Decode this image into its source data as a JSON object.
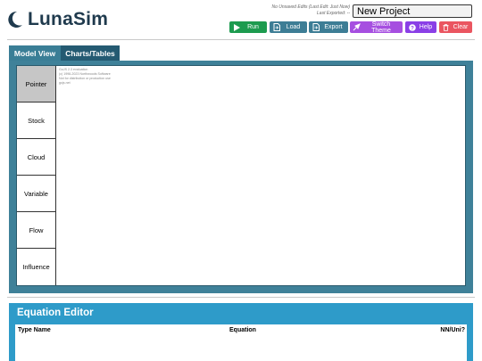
{
  "app": {
    "title": "LunaSim",
    "saved_note_line1": "No Unsaved Edits (Last Edit: Just Now)",
    "saved_note_line2": "Last Exported: --",
    "project_name": "New Project"
  },
  "toolbar": {
    "buttons": [
      {
        "label": "Run",
        "icon": "play-icon",
        "color": "#1d9b4f"
      },
      {
        "label": "Load",
        "icon": "file-load-icon",
        "color": "#3d7d95"
      },
      {
        "label": "Export",
        "icon": "file-export-icon",
        "color": "#3d7d95"
      },
      {
        "label": "Switch Theme",
        "icon": "theme-icon",
        "color": "#a64fe0"
      },
      {
        "label": "Help",
        "icon": "help-icon",
        "color": "#8a3fe6"
      },
      {
        "label": "Clear",
        "icon": "trash-icon",
        "color": "#ea5560"
      }
    ]
  },
  "model_view": {
    "tabs": [
      {
        "label": "Model View",
        "active": true
      },
      {
        "label": "Charts/Tables",
        "active": false
      }
    ],
    "palette": [
      "Pointer",
      "Stock",
      "Cloud",
      "Variable",
      "Flow",
      "Influence"
    ],
    "selected_tool": "Pointer",
    "eval_note": [
      "GoJS 2.3 evaluation",
      "(c) 1998-2023 Northwoods Software",
      "Not for distribution or production use",
      "gojs.net"
    ]
  },
  "equation_editor": {
    "title": "Equation Editor",
    "columns": [
      "Type Name",
      "Equation",
      "NN/Uni?"
    ]
  },
  "colors": {
    "panel_teal": "#3f8199",
    "editor_blue": "#2e9bc9",
    "tab_dark": "#245a72"
  }
}
